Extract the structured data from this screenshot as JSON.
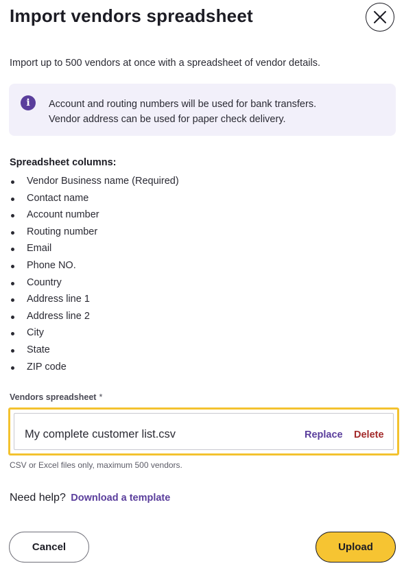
{
  "dialog": {
    "title": "Import vendors spreadsheet",
    "close_icon": "close-icon",
    "intro": "Import up to 500 vendors at once with a spreadsheet of vendor details."
  },
  "info_banner": {
    "icon": "info-icon",
    "icon_glyph": "i",
    "line1": "Account and routing numbers will be used for bank transfers.",
    "line2": "Vendor address can be used for paper check delivery."
  },
  "columns": {
    "heading": "Spreadsheet columns:",
    "items": [
      "Vendor Business name (Required)",
      "Contact name",
      "Account number",
      "Routing number",
      "Email",
      "Phone NO.",
      "Country",
      "Address line 1",
      "Address line 2",
      "City",
      "State",
      "ZIP code"
    ]
  },
  "upload_field": {
    "label": "Vendors spreadsheet",
    "required_marker": "*",
    "file_name": "My complete customer list.csv",
    "replace_label": "Replace",
    "delete_label": "Delete",
    "helper": "CSV or Excel files only, maximum 500 vendors."
  },
  "help": {
    "prompt": "Need help?",
    "link": "Download a template"
  },
  "footer": {
    "cancel_label": "Cancel",
    "upload_label": "Upload"
  },
  "colors": {
    "accent": "#5a3e9c",
    "highlight": "#f3c22f",
    "primary_button": "#f6c432",
    "danger": "#a32a2a",
    "info_bg": "#f2f0fa"
  }
}
